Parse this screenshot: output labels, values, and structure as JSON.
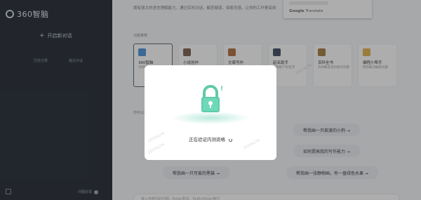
{
  "sidebar": {
    "logo_text": "360智脑",
    "new_chat_label": "开启新对话",
    "history": [
      "历史记录",
      "最近对话"
    ],
    "feedback_label": "问题反馈"
  },
  "main": {
    "intro_text": "拥有强大的语言理解能力，通过实时对话，解答疑惑，探索灵感，让你的工作更高效",
    "assistants_title": "功能推荐",
    "cards": [
      {
        "name": "360智脑",
        "desc": "为你提供日常问答服务",
        "color": "#4a90d9"
      },
      {
        "name": "小说创作",
        "desc": "帮你创作精彩小说",
        "color": "#7a5c4a"
      },
      {
        "name": "文章写作",
        "desc": "帮你撰写各类文章",
        "color": "#b06c3c"
      },
      {
        "name": "起名助手",
        "desc": "帮你取个好名字",
        "color": "#3a4a5c"
      },
      {
        "name": "百科全书",
        "desc": "为你解答百科知识问题",
        "color": "#a77a3a"
      },
      {
        "name": "编程小帮手",
        "desc": "帮你解决编程问题",
        "color": "#e0b24a"
      }
    ],
    "prompts_title": "你可以这样问我",
    "prompts": [
      "帮我画一只摇滚的小狗 →",
      "如何提高我的写作能力 →",
      "帮我画一只可爱的黑猫 →",
      "帮我画一张静物画，有一盘绿色水果 →"
    ],
    "input_placeholder": "输入你想问的问题，Enter发送，Shift+Enter换行"
  },
  "translate": {
    "brand_google": "Google",
    "brand_translate": "Translate"
  },
  "watermark_text": "15374174",
  "dialog": {
    "status_text": "正在验证内测资格"
  }
}
